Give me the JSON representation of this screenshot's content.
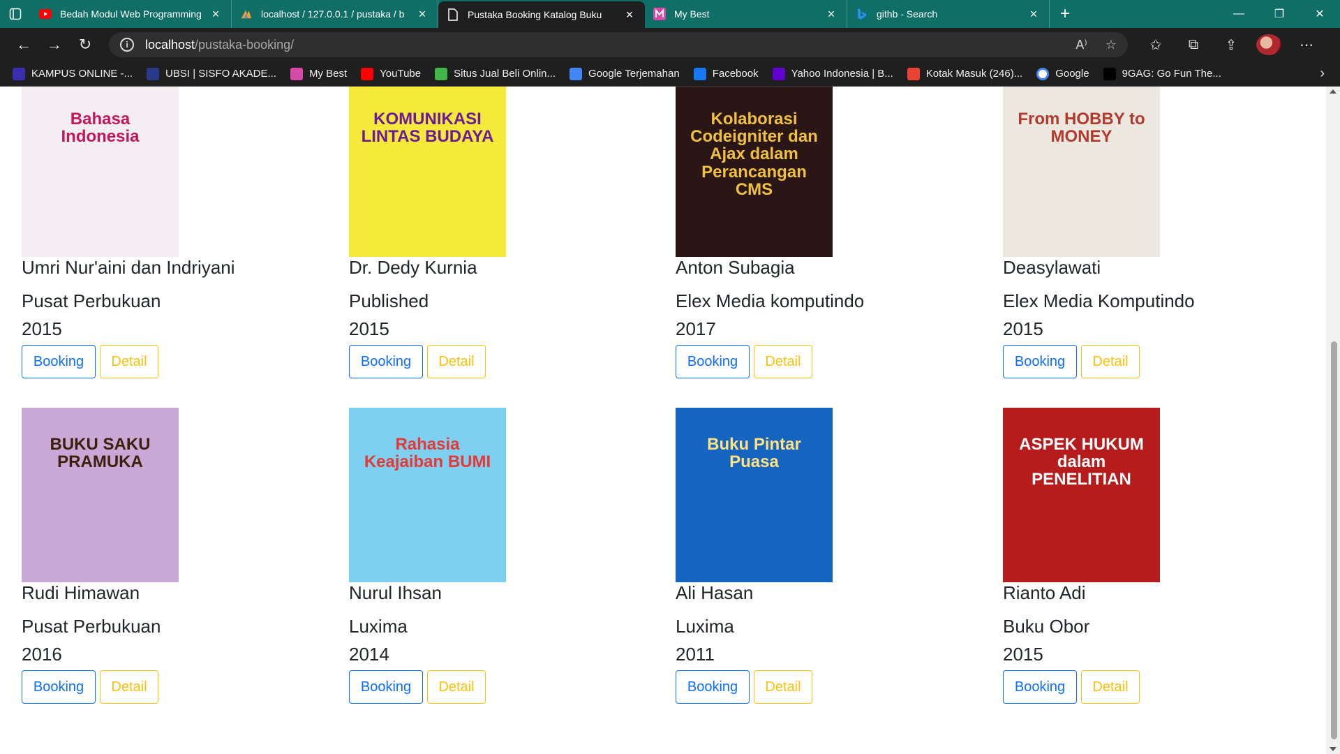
{
  "browser": {
    "tabs": [
      {
        "title": "Bedah Modul Web Programming",
        "icon": "youtube-icon",
        "color": "#ff0000"
      },
      {
        "title": "localhost / 127.0.0.1 / pustaka / b",
        "icon": "phpmyadmin-icon",
        "color": "#f0a030"
      },
      {
        "title": "Pustaka Booking Katalog Buku",
        "icon": "page-icon",
        "color": "#ffffff"
      },
      {
        "title": "My Best",
        "icon": "mybest-icon",
        "color": "#d64ba8"
      },
      {
        "title": "githb - Search",
        "icon": "bing-icon",
        "color": "#2b8ff0"
      }
    ],
    "address": {
      "host": "localhost",
      "path": "/pustaka-booking/"
    },
    "bookmarks": [
      {
        "label": "KAMPUS ONLINE -...",
        "icon": "bsi-icon",
        "color": "#3b2fb0"
      },
      {
        "label": "UBSI | SISFO AKADE...",
        "icon": "ubsi-icon",
        "color": "#2a3a8a"
      },
      {
        "label": "My Best",
        "icon": "mybest-icon",
        "color": "#d64ba8"
      },
      {
        "label": "YouTube",
        "icon": "youtube-icon",
        "color": "#ff0000"
      },
      {
        "label": "Situs Jual Beli Onlin...",
        "icon": "tokopedia-icon",
        "color": "#42b549"
      },
      {
        "label": "Google Terjemahan",
        "icon": "google-translate-icon",
        "color": "#4285f4"
      },
      {
        "label": "Facebook",
        "icon": "facebook-icon",
        "color": "#1877f2"
      },
      {
        "label": "Yahoo Indonesia | B...",
        "icon": "yahoo-icon",
        "color": "#6001d2"
      },
      {
        "label": "Kotak Masuk (246)...",
        "icon": "gmail-icon",
        "color": "#ea4335"
      },
      {
        "label": "Google",
        "icon": "google-icon",
        "color": "#ffffff"
      },
      {
        "label": "9GAG: Go Fun The...",
        "icon": "9gag-icon",
        "color": "#000000"
      }
    ]
  },
  "buttons": {
    "booking": "Booking",
    "detail": "Detail"
  },
  "books": [
    {
      "author": "Umri Nur'aini dan Indriyani",
      "publisher": "Pusat Perbukuan",
      "year": "2015",
      "cover_title": "Bahasa Indonesia",
      "cover_bg": "#f4eef2",
      "cover_fg": "#c2185b"
    },
    {
      "author": "Dr. Dedy Kurnia",
      "publisher": "Published",
      "year": "2015",
      "cover_title": "KOMUNIKASI LINTAS BUDAYA",
      "cover_bg": "#f5e93a",
      "cover_fg": "#6a1b9a"
    },
    {
      "author": "Anton Subagia",
      "publisher": "Elex Media komputindo",
      "year": "2017",
      "cover_title": "Kolaborasi Codeigniter dan Ajax dalam Perancangan CMS",
      "cover_bg": "#2a1614",
      "cover_fg": "#f0c040"
    },
    {
      "author": "Deasylawati",
      "publisher": "Elex Media Komputindo",
      "year": "2015",
      "cover_title": "From HOBBY to MONEY",
      "cover_bg": "#ece8e0",
      "cover_fg": "#b03a2e"
    },
    {
      "author": "Rudi Himawan",
      "publisher": "Pusat Perbukuan",
      "year": "2016",
      "cover_title": "BUKU SAKU PRAMUKA",
      "cover_bg": "#c9a7d6",
      "cover_fg": "#3b1f0a"
    },
    {
      "author": "Nurul Ihsan",
      "publisher": "Luxima",
      "year": "2014",
      "cover_title": "Rahasia Keajaiban BUMI",
      "cover_bg": "#7fd0f0",
      "cover_fg": "#e53935"
    },
    {
      "author": "Ali Hasan",
      "publisher": "Luxima",
      "year": "2011",
      "cover_title": "Buku Pintar Puasa",
      "cover_bg": "#1565c0",
      "cover_fg": "#ffe082"
    },
    {
      "author": "Rianto Adi",
      "publisher": "Buku Obor",
      "year": "2015",
      "cover_title": "ASPEK HUKUM dalam PENELITIAN",
      "cover_bg": "#b71c1c",
      "cover_fg": "#ffffff"
    }
  ]
}
